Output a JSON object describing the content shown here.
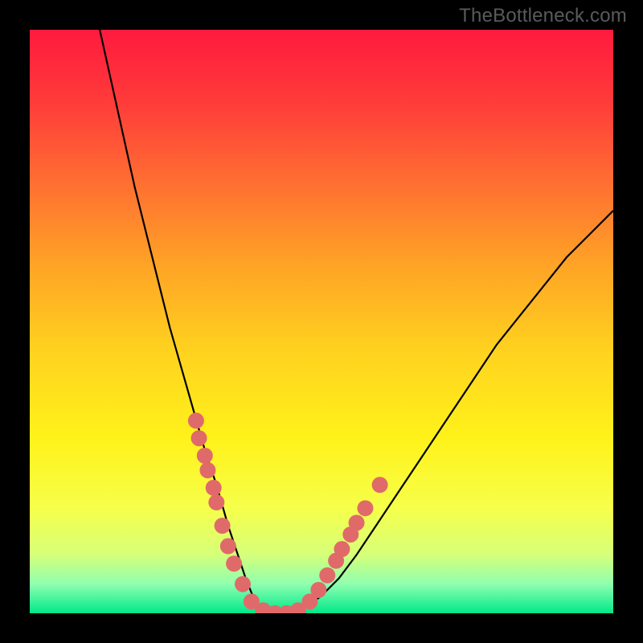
{
  "watermark": "TheBottleneck.com",
  "chart_data": {
    "type": "line",
    "title": "",
    "xlabel": "",
    "ylabel": "",
    "xlim": [
      0,
      100
    ],
    "ylim": [
      0,
      100
    ],
    "grid": false,
    "series": [
      {
        "name": "curve",
        "x": [
          12,
          14,
          16,
          18,
          20,
          22,
          24,
          26,
          28,
          30,
          32,
          34,
          35,
          36,
          37,
          38,
          39,
          40,
          42,
          44,
          46,
          48,
          50,
          53,
          56,
          60,
          64,
          68,
          72,
          76,
          80,
          84,
          88,
          92,
          96,
          100
        ],
        "y": [
          100,
          91,
          82,
          73,
          65,
          57,
          49,
          42,
          35,
          28,
          22,
          15,
          12,
          9,
          6,
          3.5,
          1.5,
          0.5,
          0,
          0,
          0.5,
          1.5,
          3,
          6,
          10,
          16,
          22,
          28,
          34,
          40,
          46,
          51,
          56,
          61,
          65,
          69
        ]
      }
    ],
    "markers": {
      "name": "highlighted-points",
      "color": "#e06a6a",
      "points": [
        {
          "x": 28.5,
          "y": 33
        },
        {
          "x": 29.0,
          "y": 30
        },
        {
          "x": 30.0,
          "y": 27
        },
        {
          "x": 30.5,
          "y": 24.5
        },
        {
          "x": 31.5,
          "y": 21.5
        },
        {
          "x": 32.0,
          "y": 19
        },
        {
          "x": 33.0,
          "y": 15
        },
        {
          "x": 34.0,
          "y": 11.5
        },
        {
          "x": 35.0,
          "y": 8.5
        },
        {
          "x": 36.5,
          "y": 5
        },
        {
          "x": 38.0,
          "y": 2
        },
        {
          "x": 40.0,
          "y": 0.5
        },
        {
          "x": 42.0,
          "y": 0
        },
        {
          "x": 44.0,
          "y": 0
        },
        {
          "x": 46.0,
          "y": 0.5
        },
        {
          "x": 48.0,
          "y": 2
        },
        {
          "x": 49.5,
          "y": 4
        },
        {
          "x": 51.0,
          "y": 6.5
        },
        {
          "x": 52.5,
          "y": 9
        },
        {
          "x": 53.5,
          "y": 11
        },
        {
          "x": 55.0,
          "y": 13.5
        },
        {
          "x": 56.0,
          "y": 15.5
        },
        {
          "x": 57.5,
          "y": 18
        },
        {
          "x": 60.0,
          "y": 22
        }
      ]
    },
    "gradient_stops": [
      {
        "offset": 0.0,
        "color": "#ff1a3e"
      },
      {
        "offset": 0.12,
        "color": "#ff3a3a"
      },
      {
        "offset": 0.25,
        "color": "#ff6a33"
      },
      {
        "offset": 0.4,
        "color": "#ffa226"
      },
      {
        "offset": 0.55,
        "color": "#ffd21f"
      },
      {
        "offset": 0.7,
        "color": "#fff21a"
      },
      {
        "offset": 0.82,
        "color": "#f6ff4a"
      },
      {
        "offset": 0.9,
        "color": "#d6ff7a"
      },
      {
        "offset": 0.95,
        "color": "#8fffb0"
      },
      {
        "offset": 1.0,
        "color": "#00e88a"
      }
    ]
  }
}
